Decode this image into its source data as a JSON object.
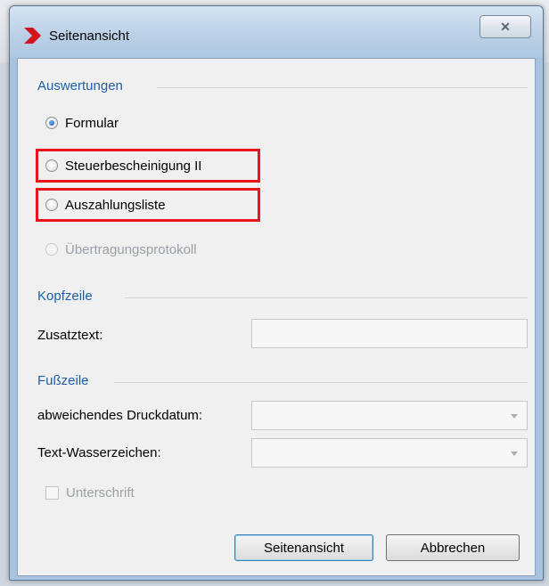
{
  "window": {
    "title": "Seitenansicht",
    "close_glyph": "✕"
  },
  "auswertungen": {
    "label": "Auswertungen",
    "options": [
      {
        "label": "Formular",
        "selected": true,
        "enabled": true
      },
      {
        "label": "Steuerbescheinigung II",
        "selected": false,
        "enabled": true
      },
      {
        "label": "Auszahlungsliste",
        "selected": false,
        "enabled": true
      },
      {
        "label": "Übertragungsprotokoll",
        "selected": false,
        "enabled": false
      }
    ]
  },
  "kopfzeile": {
    "label": "Kopfzeile",
    "zusatztext_label": "Zusatztext:",
    "zusatztext_value": ""
  },
  "fusszeile": {
    "label": "Fußzeile",
    "druckdatum_label": "abweichendes Druckdatum:",
    "druckdatum_value": "",
    "wasserzeichen_label": "Text-Wasserzeichen:",
    "wasserzeichen_value": "",
    "unterschrift_label": "Unterschrift",
    "unterschrift_checked": false
  },
  "buttons": {
    "preview": "Seitenansicht",
    "cancel": "Abbrechen"
  },
  "colors": {
    "section_label": "#1f5fa8",
    "highlight": "#e8141c",
    "app_icon": "#d4141c"
  }
}
